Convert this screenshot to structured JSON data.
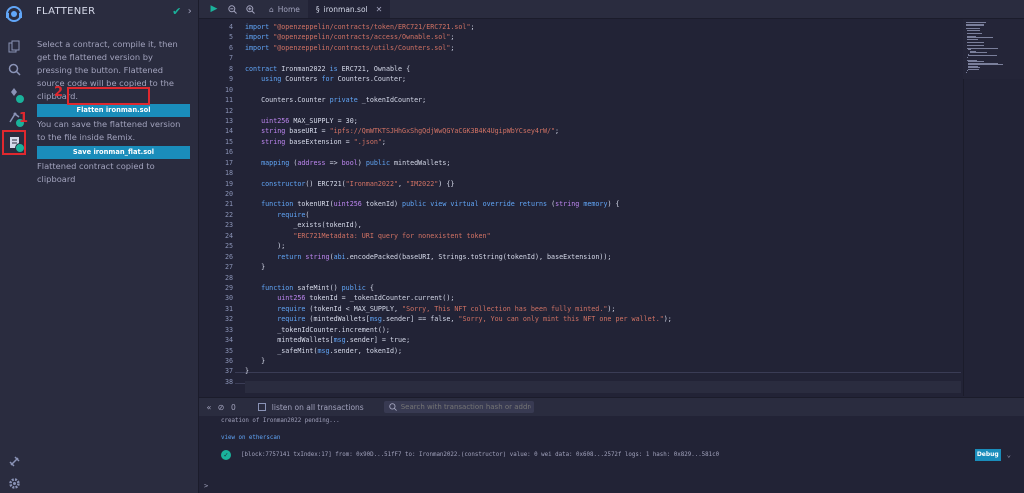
{
  "colors": {
    "accent": "#1a8dbb",
    "success": "#1ab29b",
    "callout": "#e0282e"
  },
  "plugin": {
    "title": "FLATTENER",
    "instructions": "Select a contract, compile it, then get the flattened version by pressing the button. Flattened source code will be copied to the clipboard.",
    "flatten_label": "Flatten ironman.sol",
    "save_info": "You can save the flattened version to the file inside Remix.",
    "save_label": "Save ironman_flat.sol",
    "status": "Flattened contract copied to clipboard",
    "callouts": [
      "1",
      "2"
    ]
  },
  "tabs": [
    {
      "label": "Home",
      "icon": "home-icon"
    },
    {
      "label": "ironman.sol",
      "icon": "file-icon"
    }
  ],
  "editor": {
    "line_numbers": [
      "4",
      "5",
      "6",
      "7",
      "8",
      "9",
      "10",
      "11",
      "12",
      "13",
      "14",
      "15",
      "16",
      "17",
      "18",
      "19",
      "20",
      "21",
      "22",
      "23",
      "24",
      "25",
      "26",
      "27",
      "28",
      "29",
      "30",
      "31",
      "32",
      "33",
      "34",
      "35",
      "36",
      "37",
      "38"
    ],
    "lines": [
      "import \"@openzeppelin/contracts/token/ERC721/ERC721.sol\";",
      "import \"@openzeppelin/contracts/access/Ownable.sol\";",
      "import \"@openzeppelin/contracts/utils/Counters.sol\";",
      "",
      "contract Ironman2022 is ERC721, Ownable {",
      "    using Counters for Counters.Counter;",
      "",
      "    Counters.Counter private _tokenIdCounter;",
      "",
      "    uint256 MAX_SUPPLY = 30;",
      "    string baseURI = \"ipfs://QmWTKTSJHhGxShgQdjWwQGYaCGK3B4K4UgipWbYCsey4rW/\";",
      "    string baseExtension = \".json\";",
      "",
      "    mapping (address => bool) public mintedWallets;",
      "",
      "    constructor() ERC721(\"Ironman2022\", \"IM2022\") {}",
      "",
      "    function tokenURI(uint256 tokenId) public view virtual override returns (string memory) {",
      "        require(",
      "            _exists(tokenId),",
      "            \"ERC721Metadata: URI query for nonexistent token\"",
      "        );",
      "        return string(abi.encodePacked(baseURI, Strings.toString(tokenId), baseExtension));",
      "    }",
      "",
      "    function safeMint() public {",
      "        uint256 tokenId = _tokenIdCounter.current();",
      "        require (tokenId < MAX_SUPPLY, \"Sorry, This NFT collection has been fully minted.\");",
      "        require (mintedWallets[msg.sender] == false, \"Sorry, You can only mint this NFT one per wallet.\");",
      "        _tokenIdCounter.increment();",
      "        mintedWallets[msg.sender] = true;",
      "        _safeMint(msg.sender, tokenId);",
      "    }",
      "}",
      ""
    ]
  },
  "terminal": {
    "pending_count": "0",
    "listen_label": "listen on all transactions",
    "search_placeholder": "Search with transaction hash or address",
    "pending_text": "creation of Ironman2022 pending...",
    "etherscan_link": "view on etherscan",
    "log_text": "[block:7757141 txIndex:17] from: 0x90D...51fF7 to: Ironman2022.(constructor) value: 0 wei data: 0x608...2572f logs: 1 hash: 0x829...581c0",
    "debug_label": "Debug",
    "prompt": ">"
  }
}
